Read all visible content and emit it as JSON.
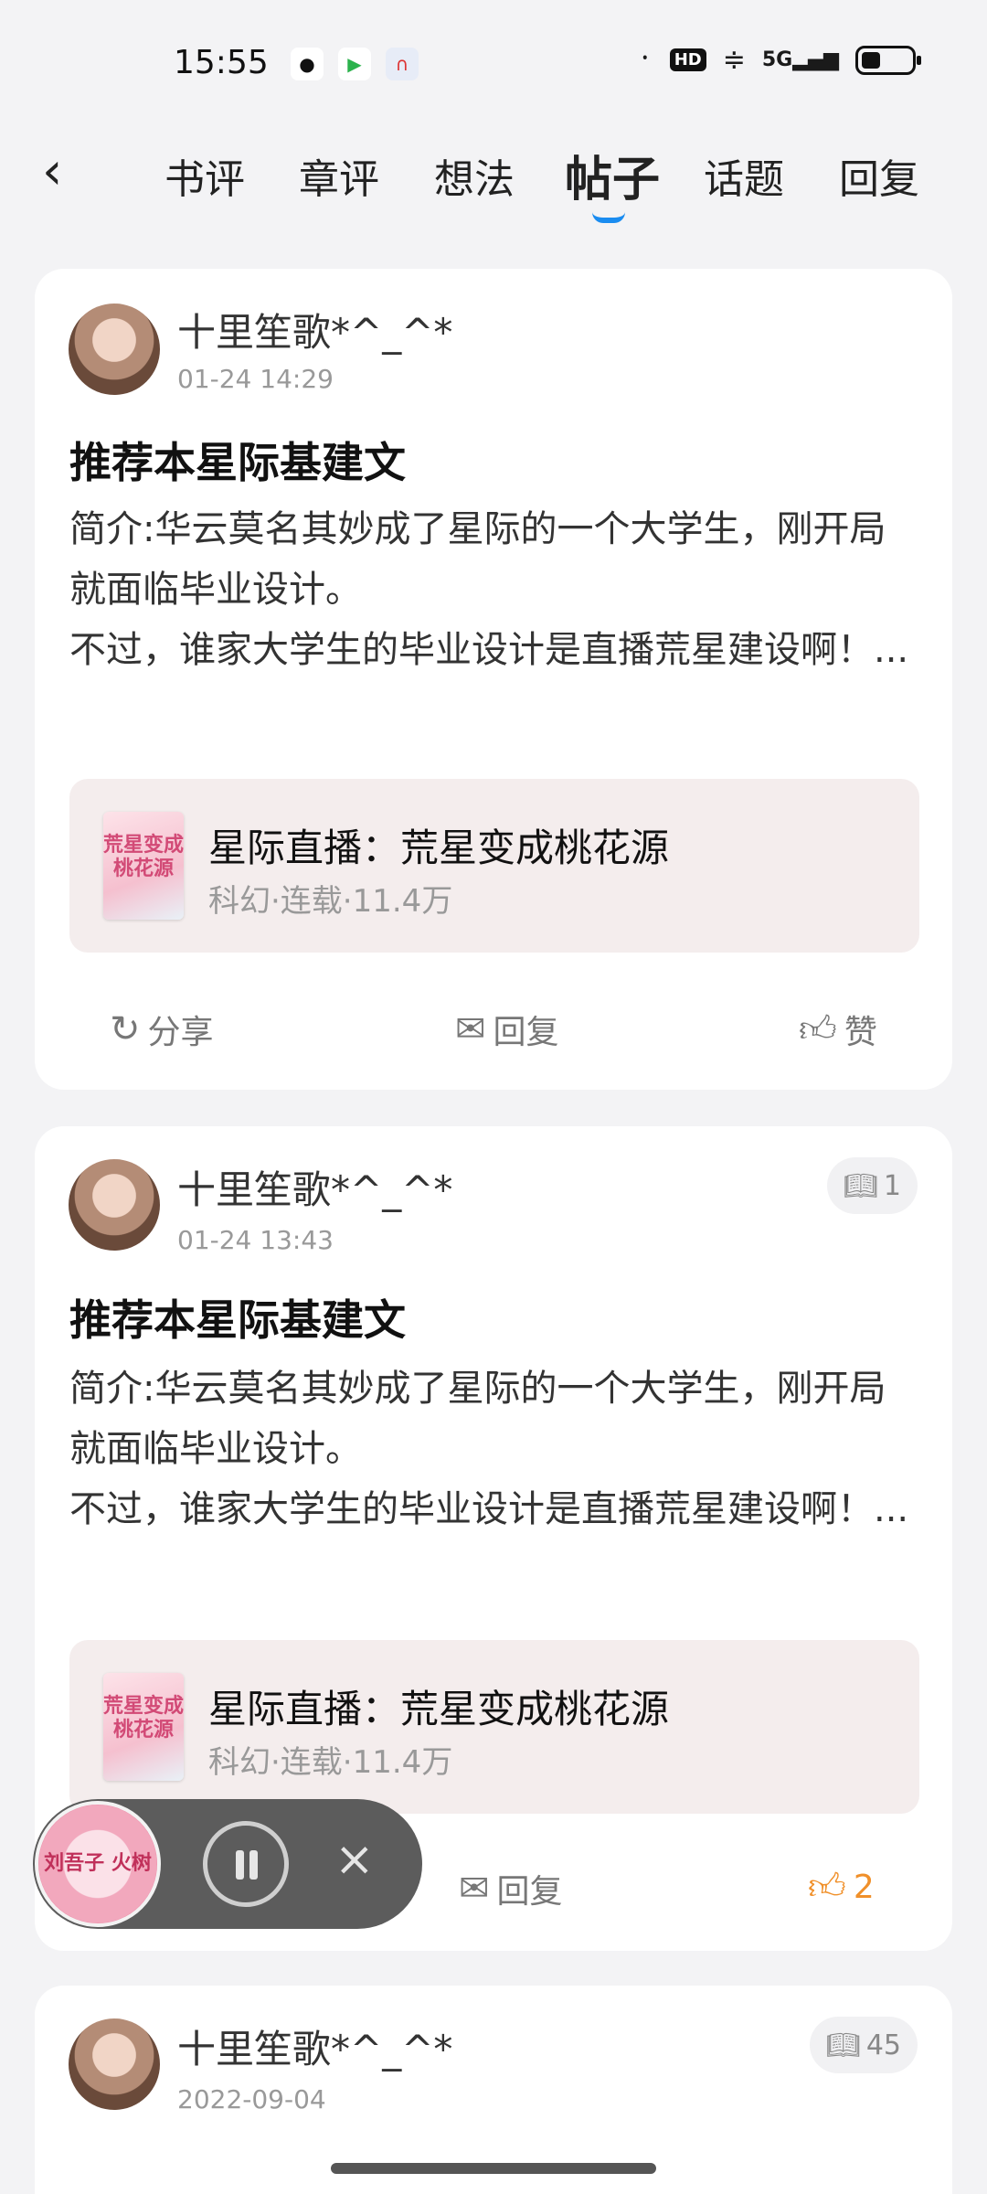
{
  "status_bar": {
    "time": "15:55",
    "network": "5G",
    "hd": "HD"
  },
  "nav": {
    "back_icon": "chevron-left-icon",
    "tabs": [
      {
        "label": "书评",
        "active": false
      },
      {
        "label": "章评",
        "active": false
      },
      {
        "label": "想法",
        "active": false
      },
      {
        "label": "帖子",
        "active": true
      },
      {
        "label": "话题",
        "active": false
      },
      {
        "label": "回复",
        "active": false
      }
    ]
  },
  "posts": [
    {
      "author": "十里笙歌*^_^*",
      "time": "01-24 14:29",
      "title": "推荐本星际基建文",
      "body_line1": "简介:华云莫名其妙成了星际的一个大学生，刚开局就面临毕业设计。",
      "body_line2": "不过，谁家大学生的毕业设计是直播荒星建设啊！...",
      "book_title": "星际直播：荒星变成桃花源",
      "book_meta": "科幻·连载·11.4万",
      "cover_text": "荒星变成桃花源",
      "share_label": "分享",
      "reply_label": "回复",
      "like_label": "赞"
    },
    {
      "author": "十里笙歌*^_^*",
      "time": "01-24 13:43",
      "badge": "1",
      "title": "推荐本星际基建文",
      "body_line1": "简介:华云莫名其妙成了星际的一个大学生，刚开局就面临毕业设计。",
      "body_line2": "不过，谁家大学生的毕业设计是直播荒星建设啊！...",
      "book_title": "星际直播：荒星变成桃花源",
      "book_meta": "科幻·连载·11.4万",
      "cover_text": "荒星变成桃花源",
      "reply_label": "回复",
      "like_count": "2"
    },
    {
      "author": "十里笙歌*^_^*",
      "time": "2022-09-04",
      "badge": "45"
    }
  ],
  "player": {
    "cover_text": "刘吾子 火树"
  },
  "colors": {
    "accent": "#1a8cf0",
    "like_active": "#f0902a",
    "card_bg": "#ffffff",
    "page_bg": "#f3f3f5"
  }
}
